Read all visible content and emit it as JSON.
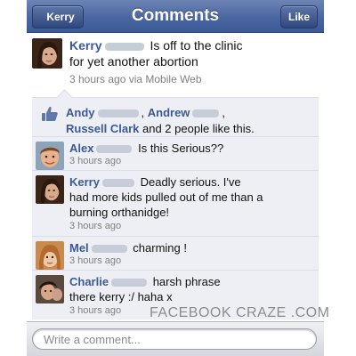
{
  "nav": {
    "back_label": "Kerry",
    "title": "Comments",
    "like_label": "Like"
  },
  "post": {
    "author": "Kerry",
    "text_line1": "Is off to the clinic",
    "text_line2": "for yet another abortion",
    "meta": "3 hours ago via Mobile Web"
  },
  "likes": {
    "name1": "Andy",
    "name2": "Andrew",
    "name3": "Russell Clark",
    "rest": "and 2 people like this."
  },
  "comments": [
    {
      "author": "Alex",
      "line1": "Is this Serious??",
      "line2": "",
      "line3": "",
      "time": "3 hours ago"
    },
    {
      "author": "Kerry",
      "line1": "Deadly serious. I've",
      "line2": "had more kids pulled out of me than a",
      "line3": "burning orthanidge!",
      "time": "3 hours ago"
    },
    {
      "author": "Mel",
      "line1": "charming !",
      "line2": "",
      "line3": "",
      "time": "3 hours ago"
    },
    {
      "author": "Charlie",
      "line1": "harsh phrase",
      "line2": "there kerry :/ haha x",
      "line3": "",
      "time": "3 hours ago"
    }
  ],
  "watermark": "FACEBOOK CRAZE .COM",
  "composer": {
    "placeholder": "Write a comment...",
    "value": ""
  },
  "colors": {
    "nav_blue": "#3b5998",
    "name_link": "#3b5998",
    "comment_bg": "#edeff4",
    "meta_gray": "#7f7f7f"
  },
  "icons": [
    "back-chevron-icon",
    "thumbs-up-icon"
  ]
}
